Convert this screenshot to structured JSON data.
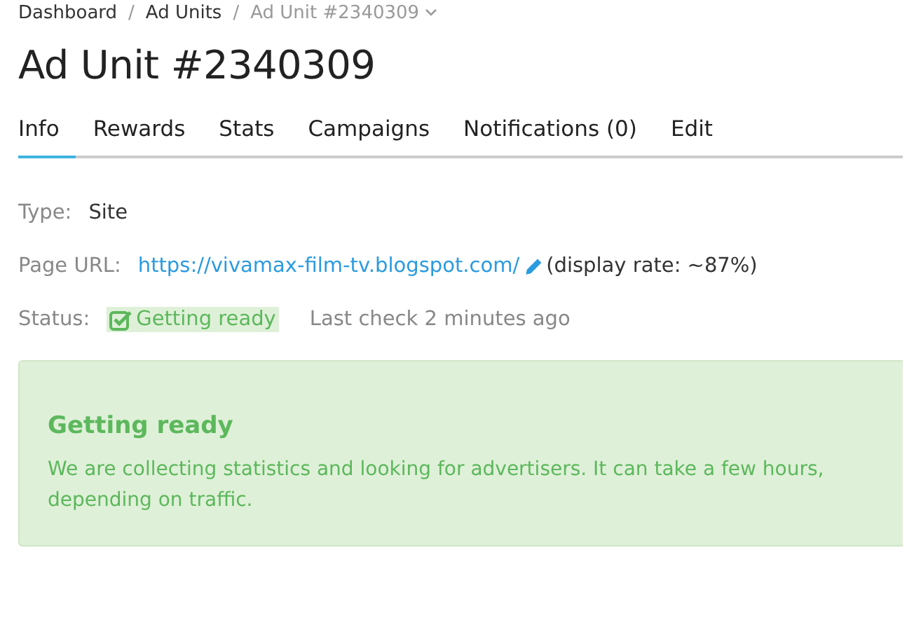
{
  "breadcrumb": [
    {
      "label": "Dashboard",
      "current": false
    },
    {
      "label": "Ad Units",
      "current": false
    },
    {
      "label": "Ad Unit #2340309",
      "current": true
    }
  ],
  "breadcrumb_separator": "/",
  "title": "Ad Unit #2340309",
  "tabs": [
    {
      "label": "Info",
      "selected": true
    },
    {
      "label": "Rewards",
      "selected": false
    },
    {
      "label": "Stats",
      "selected": false
    },
    {
      "label": "Campaigns",
      "selected": false
    },
    {
      "label": "Notifications (0)",
      "selected": false
    },
    {
      "label": "Edit",
      "selected": false
    }
  ],
  "details": {
    "type_label": "Type:",
    "type_value": "Site",
    "url_label": "Page URL:",
    "url": "https://vivamax-film-tv.blogspot.com/",
    "display_rate": "(display rate: ~87%)",
    "status_label": "Status:",
    "status": "Getting ready",
    "last_check": "Last check 2 minutes ago"
  },
  "alert": {
    "title": "Getting ready",
    "message": "We are collecting statistics and looking for advertisers. It can take a few hours, depending on traffic."
  }
}
